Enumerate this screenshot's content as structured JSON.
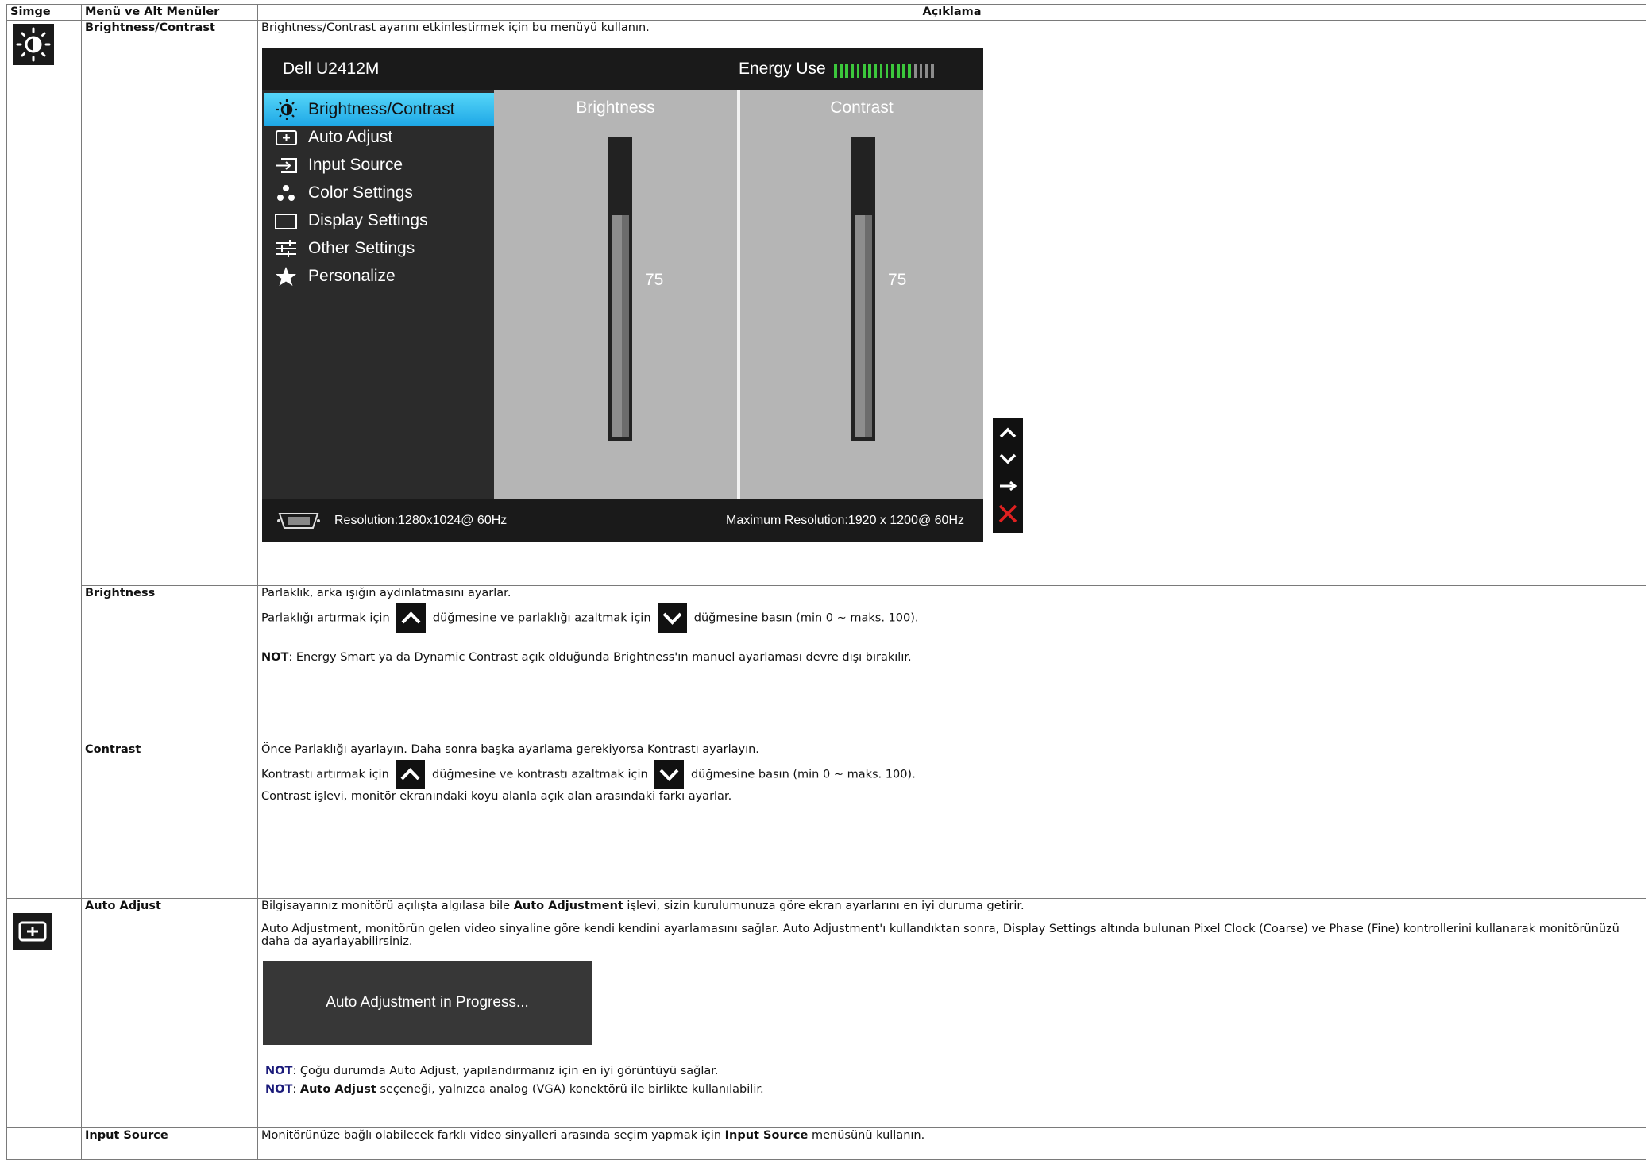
{
  "headers": {
    "icon": "Simge",
    "menu": "Menü ve Alt Menüler",
    "desc": "Açıklama"
  },
  "rows": {
    "bc": {
      "menu": "Brightness/Contrast",
      "desc": "Brightness/Contrast ayarını etkinleştirmek için bu menüyü kullanın.",
      "icon": "sun-brightness-icon"
    },
    "brightness": {
      "menu": "Brightness",
      "line1": "Parlaklık, arka ışığın aydınlatmasını ayarlar.",
      "line2_a": "Parlaklığı artırmak için",
      "line2_b": "düğmesine ve parlaklığı azaltmak için",
      "line2_c": "düğmesine basın (min 0 ~ maks. 100).",
      "note_label": "NOT",
      "note": ": Energy Smart ya da Dynamic Contrast açık olduğunda Brightness'ın manuel ayarlaması devre dışı bırakılır."
    },
    "contrast": {
      "menu": "Contrast",
      "line1": "Önce Parlaklığı ayarlayın. Daha sonra başka ayarlama gerekiyorsa Kontrastı ayarlayın.",
      "line2_a": "Kontrastı artırmak için",
      "line2_b": "düğmesine ve kontrastı azaltmak için",
      "line2_c": "düğmesine basın (min 0 ~ maks. 100).",
      "line3": "Contrast işlevi, monitör ekranındaki koyu alanla açık alan arasındaki farkı ayarlar."
    },
    "auto": {
      "menu": "Auto Adjust",
      "icon": "auto-adjust-icon",
      "l1_a": "Bilgisayarınız monitörü açılışta algılasa bile ",
      "l1_b": "Auto Adjustment",
      "l1_c": " işlevi, sizin kurulumunuza göre ekran ayarlarını en iyi duruma getirir.",
      "l2": "Auto Adjustment, monitörün gelen video sinyaline göre kendi kendini ayarlamasını sağlar. Auto Adjustment'ı kullandıktan sonra, Display Settings altında bulunan Pixel Clock (Coarse) ve Phase (Fine) kontrollerini kullanarak monitörünüzü daha da ayarlayabilirsiniz.",
      "progress": "Auto Adjustment  in Progress...",
      "n1_label": "NOT",
      "n1": ": Çoğu durumda Auto Adjust, yapılandırmanız için en iyi görüntüyü sağlar.",
      "n2_label": "NOT",
      "n2_b": "Auto Adjust",
      "n2": " seçeneği, yalnızca analog (VGA) konektörü ile birlikte kullanılabilir."
    },
    "input": {
      "menu": "Input Source",
      "l_a": "Monitörünüze bağlı olabilecek farklı video sinyalleri arasında seçim yapmak için ",
      "l_b": "Input Source",
      "l_c": " menüsünü kullanın."
    }
  },
  "osd": {
    "model": "Dell U2412M",
    "energy_label": "Energy Use",
    "energy_total": 18,
    "energy_on": 14,
    "energy_on_color": "#3cc83c",
    "energy_off_color": "#8c8c8c",
    "menu": [
      {
        "label": "Brightness/Contrast",
        "icon": "sun-icon",
        "selected": true
      },
      {
        "label": "Auto Adjust",
        "icon": "auto-adjust-icon"
      },
      {
        "label": "Input Source",
        "icon": "input-source-icon"
      },
      {
        "label": "Color Settings",
        "icon": "color-dots-icon"
      },
      {
        "label": "Display Settings",
        "icon": "display-rect-icon"
      },
      {
        "label": "Other Settings",
        "icon": "sliders-icon"
      },
      {
        "label": "Personalize",
        "icon": "star-icon"
      }
    ],
    "brightness": {
      "title": "Brightness",
      "value": "75",
      "level": 75
    },
    "contrast": {
      "title": "Contrast",
      "value": "75",
      "level": 75
    },
    "resolution": "Resolution:1280x1024@ 60Hz",
    "max_resolution": "Maximum Resolution:1920 x 1200@ 60Hz",
    "buttons": [
      "up-arrow-icon",
      "down-arrow-icon",
      "right-arrow-icon",
      "close-icon"
    ],
    "close_color": "#e02020"
  }
}
